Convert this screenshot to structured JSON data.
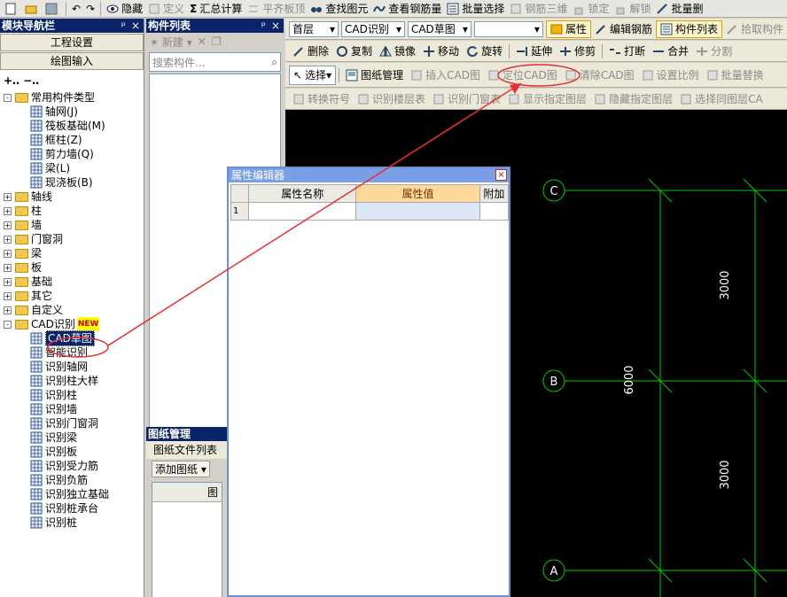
{
  "toolbar1": {
    "items": [
      "隐藏",
      "定义",
      "汇总计算",
      "平齐板顶",
      "查找图元",
      "查看钢筋量",
      "批量选择",
      "钢筋三维",
      "锁定",
      "解锁",
      "批量删"
    ]
  },
  "nav": {
    "title": "模块导航栏",
    "pin": "ᵖ",
    "close": "×",
    "buttons": [
      "工程设置",
      "绘图输入"
    ],
    "tree": [
      {
        "label": "常用构件类型",
        "level": 0,
        "type": "folder",
        "expand": "-"
      },
      {
        "label": "轴网(J)",
        "level": 1,
        "type": "item"
      },
      {
        "label": "筏板基础(M)",
        "level": 1,
        "type": "item"
      },
      {
        "label": "框柱(Z)",
        "level": 1,
        "type": "item"
      },
      {
        "label": "剪力墙(Q)",
        "level": 1,
        "type": "item"
      },
      {
        "label": "梁(L)",
        "level": 1,
        "type": "item"
      },
      {
        "label": "现浇板(B)",
        "level": 1,
        "type": "item"
      },
      {
        "label": "轴线",
        "level": 0,
        "type": "folder",
        "expand": "+"
      },
      {
        "label": "柱",
        "level": 0,
        "type": "folder",
        "expand": "+"
      },
      {
        "label": "墙",
        "level": 0,
        "type": "folder",
        "expand": "+"
      },
      {
        "label": "门窗洞",
        "level": 0,
        "type": "folder",
        "expand": "+"
      },
      {
        "label": "梁",
        "level": 0,
        "type": "folder",
        "expand": "+"
      },
      {
        "label": "板",
        "level": 0,
        "type": "folder",
        "expand": "+"
      },
      {
        "label": "基础",
        "level": 0,
        "type": "folder",
        "expand": "+"
      },
      {
        "label": "其它",
        "level": 0,
        "type": "folder",
        "expand": "+"
      },
      {
        "label": "自定义",
        "level": 0,
        "type": "folder",
        "expand": "+"
      },
      {
        "label": "CAD识别",
        "level": 0,
        "type": "folder",
        "expand": "-",
        "badge": "NEW"
      },
      {
        "label": "CAD草图",
        "level": 1,
        "type": "item",
        "selected": true
      },
      {
        "label": "智能识别",
        "level": 1,
        "type": "item"
      },
      {
        "label": "识别轴网",
        "level": 1,
        "type": "item"
      },
      {
        "label": "识别柱大样",
        "level": 1,
        "type": "item"
      },
      {
        "label": "识别柱",
        "level": 1,
        "type": "item"
      },
      {
        "label": "识别墙",
        "level": 1,
        "type": "item"
      },
      {
        "label": "识别门窗洞",
        "level": 1,
        "type": "item"
      },
      {
        "label": "识别梁",
        "level": 1,
        "type": "item"
      },
      {
        "label": "识别板",
        "level": 1,
        "type": "item"
      },
      {
        "label": "识别受力筋",
        "level": 1,
        "type": "item"
      },
      {
        "label": "识别负筋",
        "level": 1,
        "type": "item"
      },
      {
        "label": "识别独立基础",
        "level": 1,
        "type": "item"
      },
      {
        "label": "识别桩承台",
        "level": 1,
        "type": "item"
      },
      {
        "label": "识别桩",
        "level": 1,
        "type": "item"
      }
    ]
  },
  "complist": {
    "title": "构件列表",
    "new_label": "新建",
    "search_placeholder": "搜索构件..."
  },
  "drawmgr": {
    "title": "图纸管理",
    "tab": "图纸文件列表",
    "add_label": "添加图纸",
    "col_header": "图"
  },
  "rtb1": {
    "floor": "首层",
    "module": "CAD识别",
    "sub": "CAD草图",
    "items": [
      "属性",
      "编辑钢筋",
      "构件列表",
      "拾取构件"
    ]
  },
  "rtb2": {
    "items": [
      "删除",
      "复制",
      "镜像",
      "移动",
      "旋转",
      "延伸",
      "修剪",
      "打断",
      "合并",
      "分割"
    ]
  },
  "rtb3": {
    "select": "选择",
    "items": [
      "图纸管理",
      "插入CAD图",
      "定位CAD图",
      "清除CAD图",
      "设置比例",
      "批量替换"
    ]
  },
  "rtb4": {
    "items": [
      "转换符号",
      "识别楼层表",
      "识别门窗表",
      "显示指定图层",
      "隐藏指定图层",
      "选择同图层CA"
    ]
  },
  "cad": {
    "axes": [
      "C",
      "B",
      "A"
    ],
    "dims": [
      "3000",
      "6000",
      "3000"
    ]
  },
  "prop": {
    "title": "属性编辑器",
    "close": "×",
    "headers": [
      "属性名称",
      "属性值",
      "附加"
    ],
    "rows": [
      {
        "idx": "1",
        "name": "",
        "value": "",
        "extra": ""
      }
    ]
  },
  "colors": {
    "annotation": "#e83030",
    "cad_grid": "#00cc00"
  }
}
